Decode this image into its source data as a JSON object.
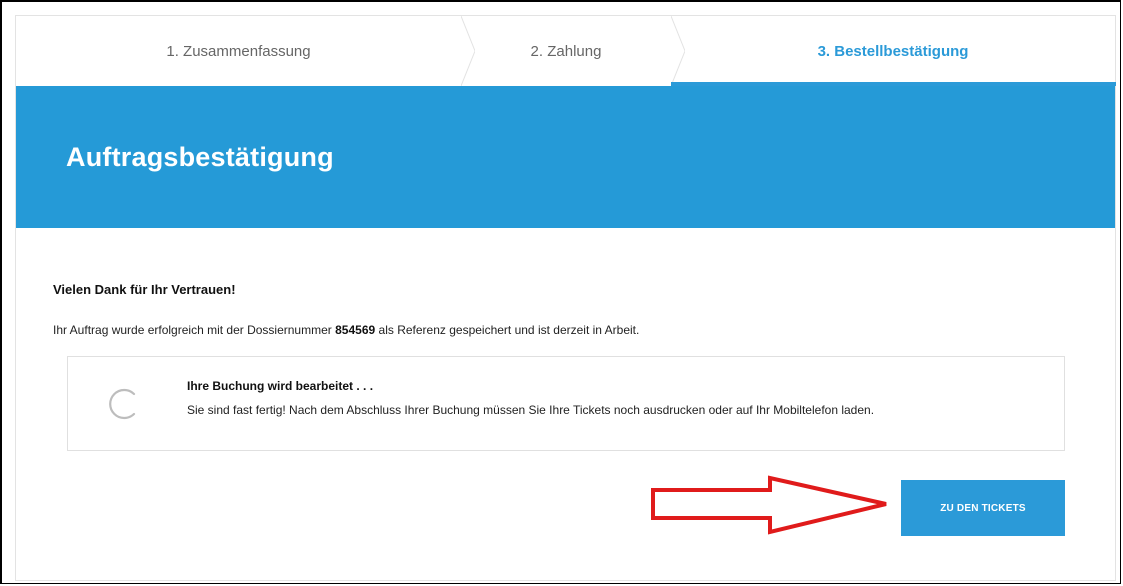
{
  "steps": [
    {
      "label": "1. Zusammenfassung",
      "active": false
    },
    {
      "label": "2. Zahlung",
      "active": false
    },
    {
      "label": "3. Bestellbestätigung",
      "active": true
    }
  ],
  "banner": {
    "title": "Auftragsbestätigung"
  },
  "content": {
    "thanks": "Vielen Dank für Ihr Vertrauen!",
    "info_prefix": "Ihr Auftrag wurde erfolgreich mit der Dossiernummer",
    "dossier_number": "854569",
    "info_suffix": "als Referenz gespeichert und ist derzeit in Arbeit."
  },
  "status": {
    "title": "Ihre Buchung wird bearbeitet . . .",
    "text": "Sie sind fast fertig! Nach dem Abschluss Ihrer Buchung müssen Sie Ihre Tickets noch ausdrucken oder auf Ihr Mobiltelefon laden.",
    "icon": "loading-spinner-icon"
  },
  "actions": {
    "tickets_button": "ZU DEN TICKETS"
  },
  "colors": {
    "accent": "#259ad7",
    "annotation_arrow": "#e01b1b"
  }
}
